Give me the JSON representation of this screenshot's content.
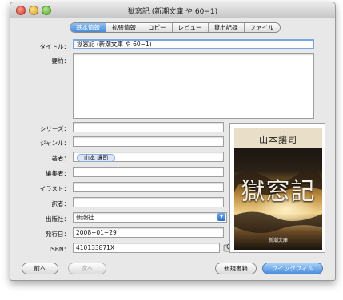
{
  "window": {
    "title": "獄窓記 (新潮文庫 や 60−1)"
  },
  "tabs": [
    {
      "label": "基本情報",
      "active": true
    },
    {
      "label": "拡張情報",
      "active": false
    },
    {
      "label": "コピー",
      "active": false
    },
    {
      "label": "レビュー",
      "active": false
    },
    {
      "label": "貸出記録",
      "active": false
    },
    {
      "label": "ファイル",
      "active": false
    }
  ],
  "form": {
    "title_label": "タイトル：",
    "title_value": "獄窓記 (新潮文庫 や 60−1)",
    "summary_label": "要約：",
    "summary_value": "",
    "series_label": "シリーズ：",
    "series_value": "",
    "genre_label": "ジャンル：",
    "genre_value": "",
    "author_label": "著者：",
    "author_token": "山本 讓司",
    "editor_label": "編集者：",
    "editor_value": "",
    "illustrator_label": "イラスト：",
    "illustrator_value": "",
    "translator_label": "訳者：",
    "translator_value": "",
    "publisher_label": "出版社：",
    "publisher_value": "新潮社",
    "date_label": "発行日：",
    "date_value": "2008−01−29",
    "isbn_label": "ISBN：",
    "isbn_value": "410133871X"
  },
  "cover": {
    "author": "山本讓司",
    "title": "獄窓記",
    "publisher": "新潮文庫",
    "colors": {
      "sky_top": "#1b1b1b",
      "sky_glow": "#d9a64a",
      "cloud": "#3a2a18"
    }
  },
  "buttons": {
    "prev": "前へ",
    "next": "次へ",
    "new_book": "新規書籍",
    "quick_fill": "クイックフィル"
  },
  "colors": {
    "accent": "#4a8fdc",
    "focus_ring": "#78a7e0"
  },
  "icons": {
    "popup": "chevron-down-icon",
    "lookup": "search-book-icon"
  }
}
